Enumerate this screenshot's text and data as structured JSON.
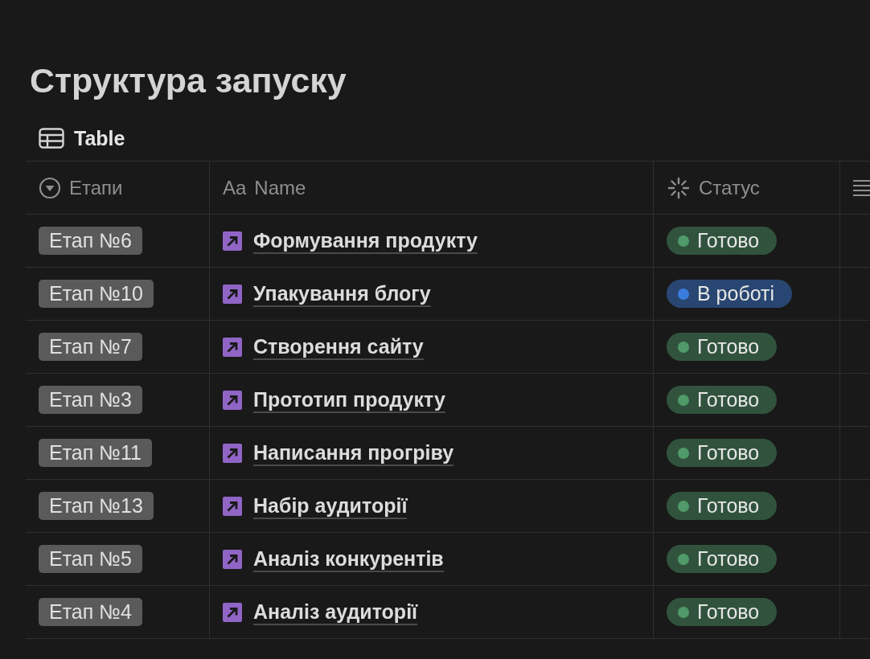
{
  "title": "Структура запуску",
  "view": {
    "label": "Table"
  },
  "table": {
    "columns": [
      {
        "label": "Етапи",
        "kind": "select"
      },
      {
        "label": "Name",
        "kind": "title",
        "icon_text": "Aa"
      },
      {
        "label": "Статус",
        "kind": "status"
      },
      {
        "kind": "text"
      }
    ],
    "rows": [
      {
        "stage": "Етап №6",
        "name": "Формування продукту",
        "status": {
          "label": "Готово",
          "color": "#4f9a68"
        }
      },
      {
        "stage": "Етап №10",
        "name": "Упакування блогу",
        "status": {
          "label": "В роботі",
          "color": "#3b7ddd"
        }
      },
      {
        "stage": "Етап №7",
        "name": "Створення сайту",
        "status": {
          "label": "Готово",
          "color": "#4f9a68"
        }
      },
      {
        "stage": "Етап №3",
        "name": "Прототип продукту",
        "status": {
          "label": "Готово",
          "color": "#4f9a68"
        }
      },
      {
        "stage": "Етап №11",
        "name": "Написання прогріву",
        "status": {
          "label": "Готово",
          "color": "#4f9a68"
        }
      },
      {
        "stage": "Етап №13",
        "name": "Набір аудиторії",
        "status": {
          "label": "Готово",
          "color": "#4f9a68"
        }
      },
      {
        "stage": "Етап №5",
        "name": "Аналіз конкурентів",
        "status": {
          "label": "Готово",
          "color": "#4f9a68"
        }
      },
      {
        "stage": "Етап №4",
        "name": "Аналіз аудиторії",
        "status": {
          "label": "Готово",
          "color": "#4f9a68"
        }
      }
    ]
  }
}
